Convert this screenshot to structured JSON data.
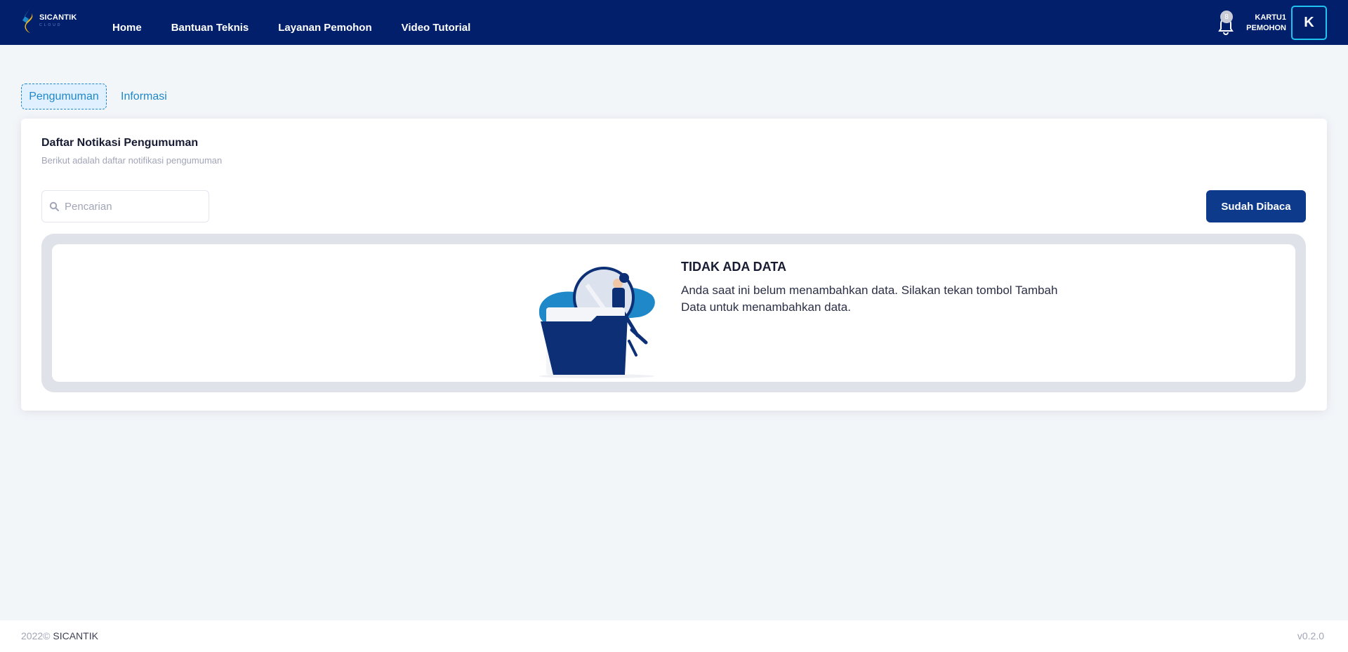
{
  "brand": {
    "name": "SICANTIK",
    "sub": "CLOUD"
  },
  "nav": {
    "items": [
      {
        "label": "Home"
      },
      {
        "label": "Bantuan Teknis"
      },
      {
        "label": "Layanan Pemohon"
      },
      {
        "label": "Video Tutorial"
      }
    ]
  },
  "header": {
    "notification_count": "8",
    "user_line1": "KARTU1",
    "user_line2": "PEMOHON",
    "avatar_letter": "K",
    "icons": {
      "bell": "bell-icon"
    }
  },
  "tabs": [
    {
      "label": "Pengumuman",
      "active": true
    },
    {
      "label": "Informasi",
      "active": false
    }
  ],
  "card": {
    "title": "Daftar Notikasi Pengumuman",
    "subtitle": "Berikut adalah daftar notifikasi pengumuman",
    "search_placeholder": "Pencarian",
    "search_value": "",
    "mark_read_label": "Sudah Dibaca",
    "empty_title": "TIDAK ADA DATA",
    "empty_desc": "Anda saat ini belum menambahkan data. Silakan tekan tombol Tambah Data untuk menambahkan data."
  },
  "footer": {
    "year": "2022©",
    "brand": "SICANTIK",
    "version": "v0.2.0"
  },
  "colors": {
    "header_bg": "#011f6b",
    "accent": "#1e88c9",
    "button_bg": "#0d3a8a",
    "page_bg": "#f3f6f9"
  }
}
